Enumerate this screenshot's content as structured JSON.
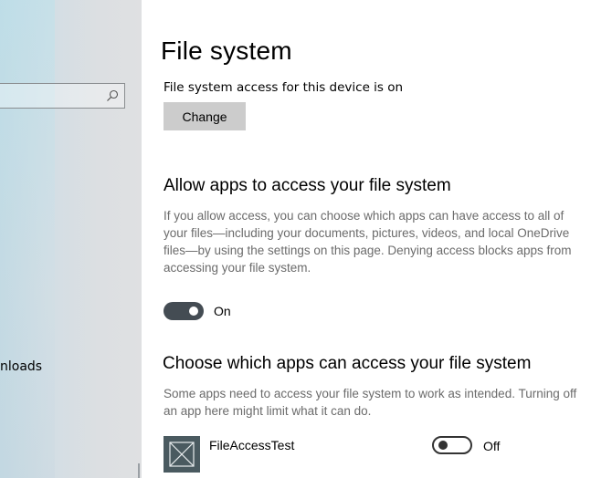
{
  "sidebar": {
    "search": {
      "placeholder": ""
    },
    "items": [
      {
        "label": "nloads"
      }
    ]
  },
  "main": {
    "page_title": "File system",
    "status_text": "File system access for this device is on",
    "change_label": "Change",
    "section1": {
      "title": "Allow apps to access your file system",
      "description": "If you allow access, you can choose which apps can have access to all of your files—including your documents, pictures, videos, and local OneDrive files—by using the settings on this page. Denying access blocks apps from accessing your file system.",
      "toggle_state": "On"
    },
    "section2": {
      "title": "Choose which apps can access your file system",
      "description": "Some apps need to access your file system to work as intended. Turning off an app here might limit what it can do.",
      "apps": [
        {
          "name": "FileAccessTest",
          "toggle_state": "Off"
        }
      ]
    }
  },
  "icons": {
    "search": "search-icon",
    "app": "app-placeholder-icon"
  },
  "colors": {
    "toggle_on_bg": "#444c53",
    "button_bg": "#cccccc",
    "description_text": "#6b6b6b"
  }
}
